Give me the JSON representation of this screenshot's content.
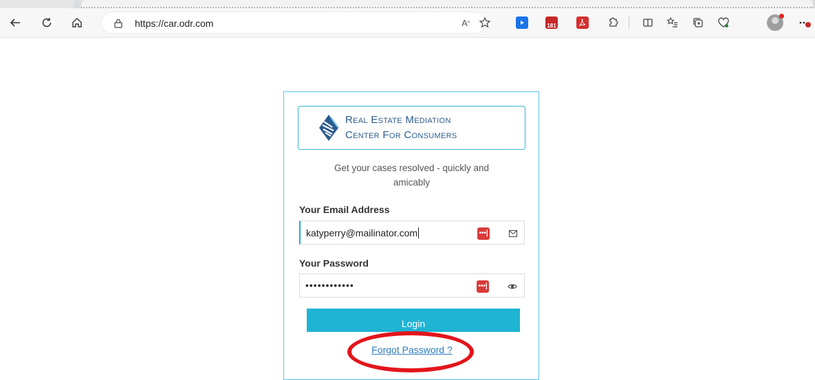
{
  "browser": {
    "url": "https://car.odr.com",
    "extensions": {
      "calendar_badge": "181",
      "password_manager_glyph": "•••|"
    },
    "colors": {
      "accent": "#1fb3d4",
      "link": "#2b7bbd",
      "annotation": "#e3151b"
    }
  },
  "login": {
    "logo_line1": "Real Estate Mediation",
    "logo_line2": "Center For Consumers",
    "tagline_line1": "Get your cases resolved - quickly and",
    "tagline_line2": "amicably",
    "email_label": "Your Email Address",
    "email_value": "katyperry@mailinator.com",
    "password_label": "Your Password",
    "password_value": "••••••••••••",
    "login_button": "Login",
    "forgot_link": "Forgot Password ?"
  }
}
